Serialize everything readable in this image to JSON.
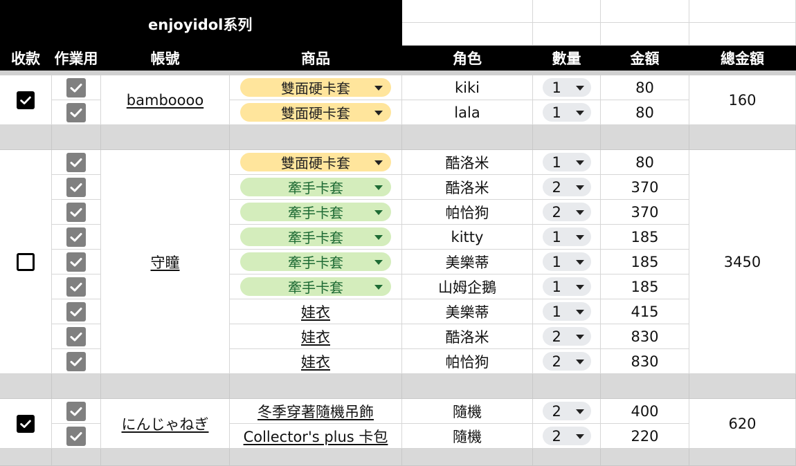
{
  "title": "enjoyidol系列",
  "headers": [
    "收款",
    "作業用",
    "帳號",
    "商品",
    "角色",
    "數量",
    "金額",
    "總金額"
  ],
  "groups": [
    {
      "paid": true,
      "account": "bamboooo",
      "total": "160",
      "rows": [
        {
          "product": "雙面硬卡套",
          "style": "yellow",
          "role": "kiki",
          "qty": "1",
          "amount": "80"
        },
        {
          "product": "雙面硬卡套",
          "style": "yellow",
          "role": "lala",
          "qty": "1",
          "amount": "80"
        }
      ]
    },
    {
      "paid": false,
      "account": "守瞳",
      "total": "3450",
      "rows": [
        {
          "product": "雙面硬卡套",
          "style": "yellow",
          "role": "酷洛米",
          "qty": "1",
          "amount": "80"
        },
        {
          "product": "牽手卡套",
          "style": "green",
          "role": "酷洛米",
          "qty": "2",
          "amount": "370"
        },
        {
          "product": "牽手卡套",
          "style": "green",
          "role": "帕恰狗",
          "qty": "2",
          "amount": "370"
        },
        {
          "product": "牽手卡套",
          "style": "green",
          "role": "kitty",
          "qty": "1",
          "amount": "185"
        },
        {
          "product": "牽手卡套",
          "style": "green",
          "role": "美樂蒂",
          "qty": "1",
          "amount": "185"
        },
        {
          "product": "牽手卡套",
          "style": "green",
          "role": "山姆企鵝",
          "qty": "1",
          "amount": "185"
        },
        {
          "product": "娃衣",
          "style": "link",
          "role": "美樂蒂",
          "qty": "1",
          "amount": "415"
        },
        {
          "product": "娃衣",
          "style": "link",
          "role": "酷洛米",
          "qty": "2",
          "amount": "830"
        },
        {
          "product": "娃衣",
          "style": "link",
          "role": "帕恰狗",
          "qty": "2",
          "amount": "830"
        }
      ]
    },
    {
      "paid": true,
      "account": "にんじゃねぎ",
      "total": "620",
      "rows": [
        {
          "product": "冬季穿著隨機吊飾",
          "style": "link",
          "role": "隨機",
          "qty": "2",
          "amount": "400"
        },
        {
          "product": "Collector's plus 卡包",
          "style": "link",
          "role": "隨機",
          "qty": "2",
          "amount": "220"
        }
      ]
    }
  ],
  "work_checked": true,
  "colors": {
    "header_bg": "#000000",
    "yellow_chip": "#ffe59c",
    "green_chip": "#d4edbc",
    "green_text": "#1e6b34",
    "separator": "#d9d9d9",
    "checkbox_grey": "#808080"
  },
  "icons": {
    "check": "check-icon",
    "dropdown": "dropdown-arrow-icon"
  }
}
